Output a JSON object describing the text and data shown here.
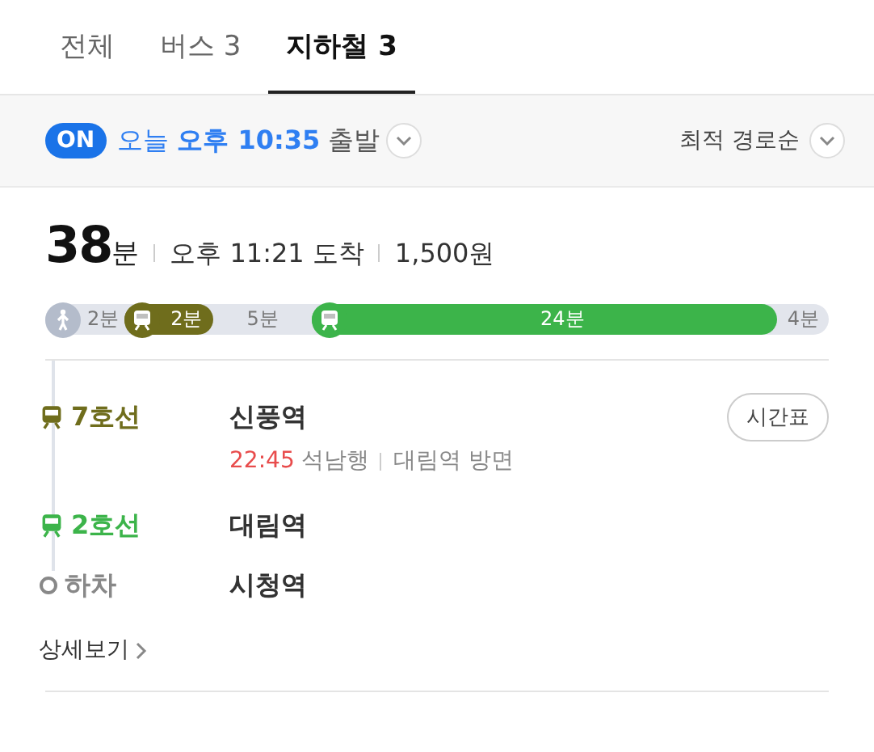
{
  "tabs": [
    {
      "label": "전체",
      "selected": false
    },
    {
      "label": "버스 3",
      "selected": false
    },
    {
      "label": "지하철 3",
      "selected": true
    }
  ],
  "departure": {
    "toggle": "ON",
    "on": true,
    "day": "오늘",
    "time": "오후 10:35",
    "suffix": "출발",
    "sort": "최적 경로순"
  },
  "summary": {
    "duration": "38",
    "unit": "분",
    "arrival": "오후 11:21 도착",
    "fare": "1,500원"
  },
  "segments": [
    {
      "kind": "walk",
      "label": "2분",
      "color": "#b4bccb"
    },
    {
      "kind": "ride",
      "label": "2분",
      "color": "#6f6d1c"
    },
    {
      "kind": "wait",
      "label": "5분"
    },
    {
      "kind": "ride",
      "label": "24분",
      "color": "#3cb44a"
    },
    {
      "kind": "wait",
      "label": "4분"
    }
  ],
  "steps": [
    {
      "kind": "ride",
      "line": "7호선",
      "color": "#6f6d1c",
      "station": "신풍역",
      "button": "시간표",
      "time": "22:45",
      "direction": "석남행",
      "toward": "대림역 방면"
    },
    {
      "kind": "ride",
      "line": "2호선",
      "color": "#3cb44a",
      "station": "대림역"
    },
    {
      "kind": "alight",
      "line": "하차",
      "color": "#888888",
      "station": "시청역"
    }
  ],
  "details": "상세보기"
}
